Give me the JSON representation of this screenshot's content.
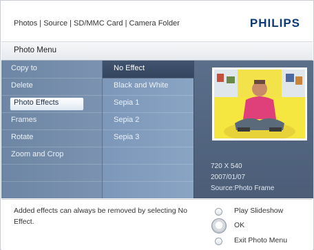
{
  "header": {
    "breadcrumb": "Photos | Source | SD/MMC Card | Camera Folder",
    "brand": "PHILIPS"
  },
  "menu": {
    "title": "Photo Menu",
    "items": [
      {
        "label": "Copy to"
      },
      {
        "label": "Delete"
      },
      {
        "label": "Photo Effects",
        "selected": true
      },
      {
        "label": "Frames"
      },
      {
        "label": "Rotate"
      },
      {
        "label": "Zoom and Crop"
      }
    ]
  },
  "effects": {
    "items": [
      {
        "label": "No Effect",
        "active": true
      },
      {
        "label": "Black and White"
      },
      {
        "label": "Sepia 1"
      },
      {
        "label": "Sepia 2"
      },
      {
        "label": "Sepia 3"
      }
    ]
  },
  "preview": {
    "resolution": "720 X 540",
    "date": "2007/01/07",
    "source": "Source:Photo Frame"
  },
  "footer": {
    "hint": "Added effects can always be removed by selecting No Effect.",
    "options": [
      {
        "label": "Play Slideshow"
      },
      {
        "label": "OK"
      },
      {
        "label": "Exit Photo Menu"
      }
    ]
  },
  "colors": {
    "brand": "#0b3a78",
    "menu_panel": "#7389a6",
    "effects_panel": "#849fc0",
    "preview_panel": "#55677f",
    "photo_background": "#f7e84a"
  }
}
